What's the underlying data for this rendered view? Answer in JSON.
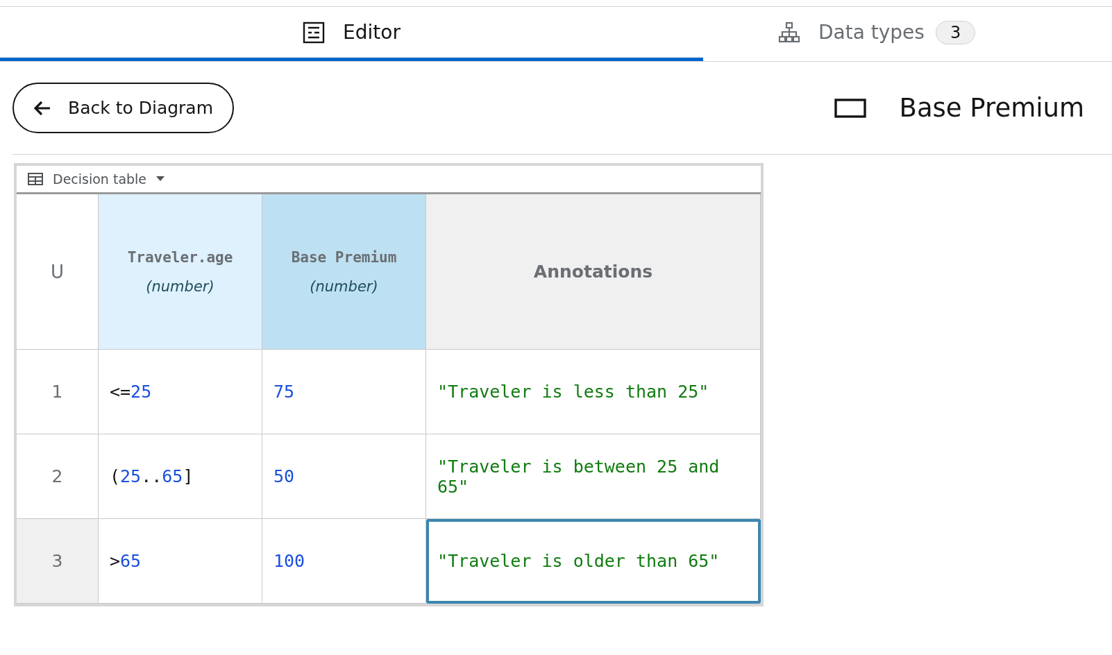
{
  "tabs": [
    {
      "label": "Editor",
      "kind": "editor",
      "selected": true
    },
    {
      "label": "Data types",
      "kind": "types",
      "badge": "3",
      "selected": false
    }
  ],
  "back_button": "Back to Diagram",
  "title": "Base Premium",
  "decision_table": {
    "toolbar_label": "Decision table",
    "hit_policy": "U",
    "columns": [
      {
        "kind": "input",
        "name": "Traveler.age",
        "type": "(number)"
      },
      {
        "kind": "output",
        "name": "Base Premium",
        "type": "(number)"
      },
      {
        "kind": "annotation",
        "name": "Annotations"
      }
    ],
    "rows": [
      {
        "number": "1",
        "selected": false,
        "input": [
          {
            "kind": "operator",
            "text": "<="
          },
          {
            "kind": "number",
            "text": "25"
          }
        ],
        "output": [
          {
            "kind": "number",
            "text": "75"
          }
        ],
        "annotation": "\"Traveler is less than 25\""
      },
      {
        "number": "2",
        "selected": false,
        "input": [
          {
            "kind": "operator",
            "text": "("
          },
          {
            "kind": "number",
            "text": "25"
          },
          {
            "kind": "operator",
            "text": ".."
          },
          {
            "kind": "number",
            "text": "65"
          },
          {
            "kind": "operator",
            "text": "]"
          }
        ],
        "output": [
          {
            "kind": "number",
            "text": "50"
          }
        ],
        "annotation": "\"Traveler is between 25 and 65\""
      },
      {
        "number": "3",
        "selected": true,
        "input": [
          {
            "kind": "operator",
            "text": ">"
          },
          {
            "kind": "number",
            "text": "65"
          }
        ],
        "output": [
          {
            "kind": "number",
            "text": "100"
          }
        ],
        "annotation": "\"Traveler is older than 65\""
      }
    ]
  }
}
